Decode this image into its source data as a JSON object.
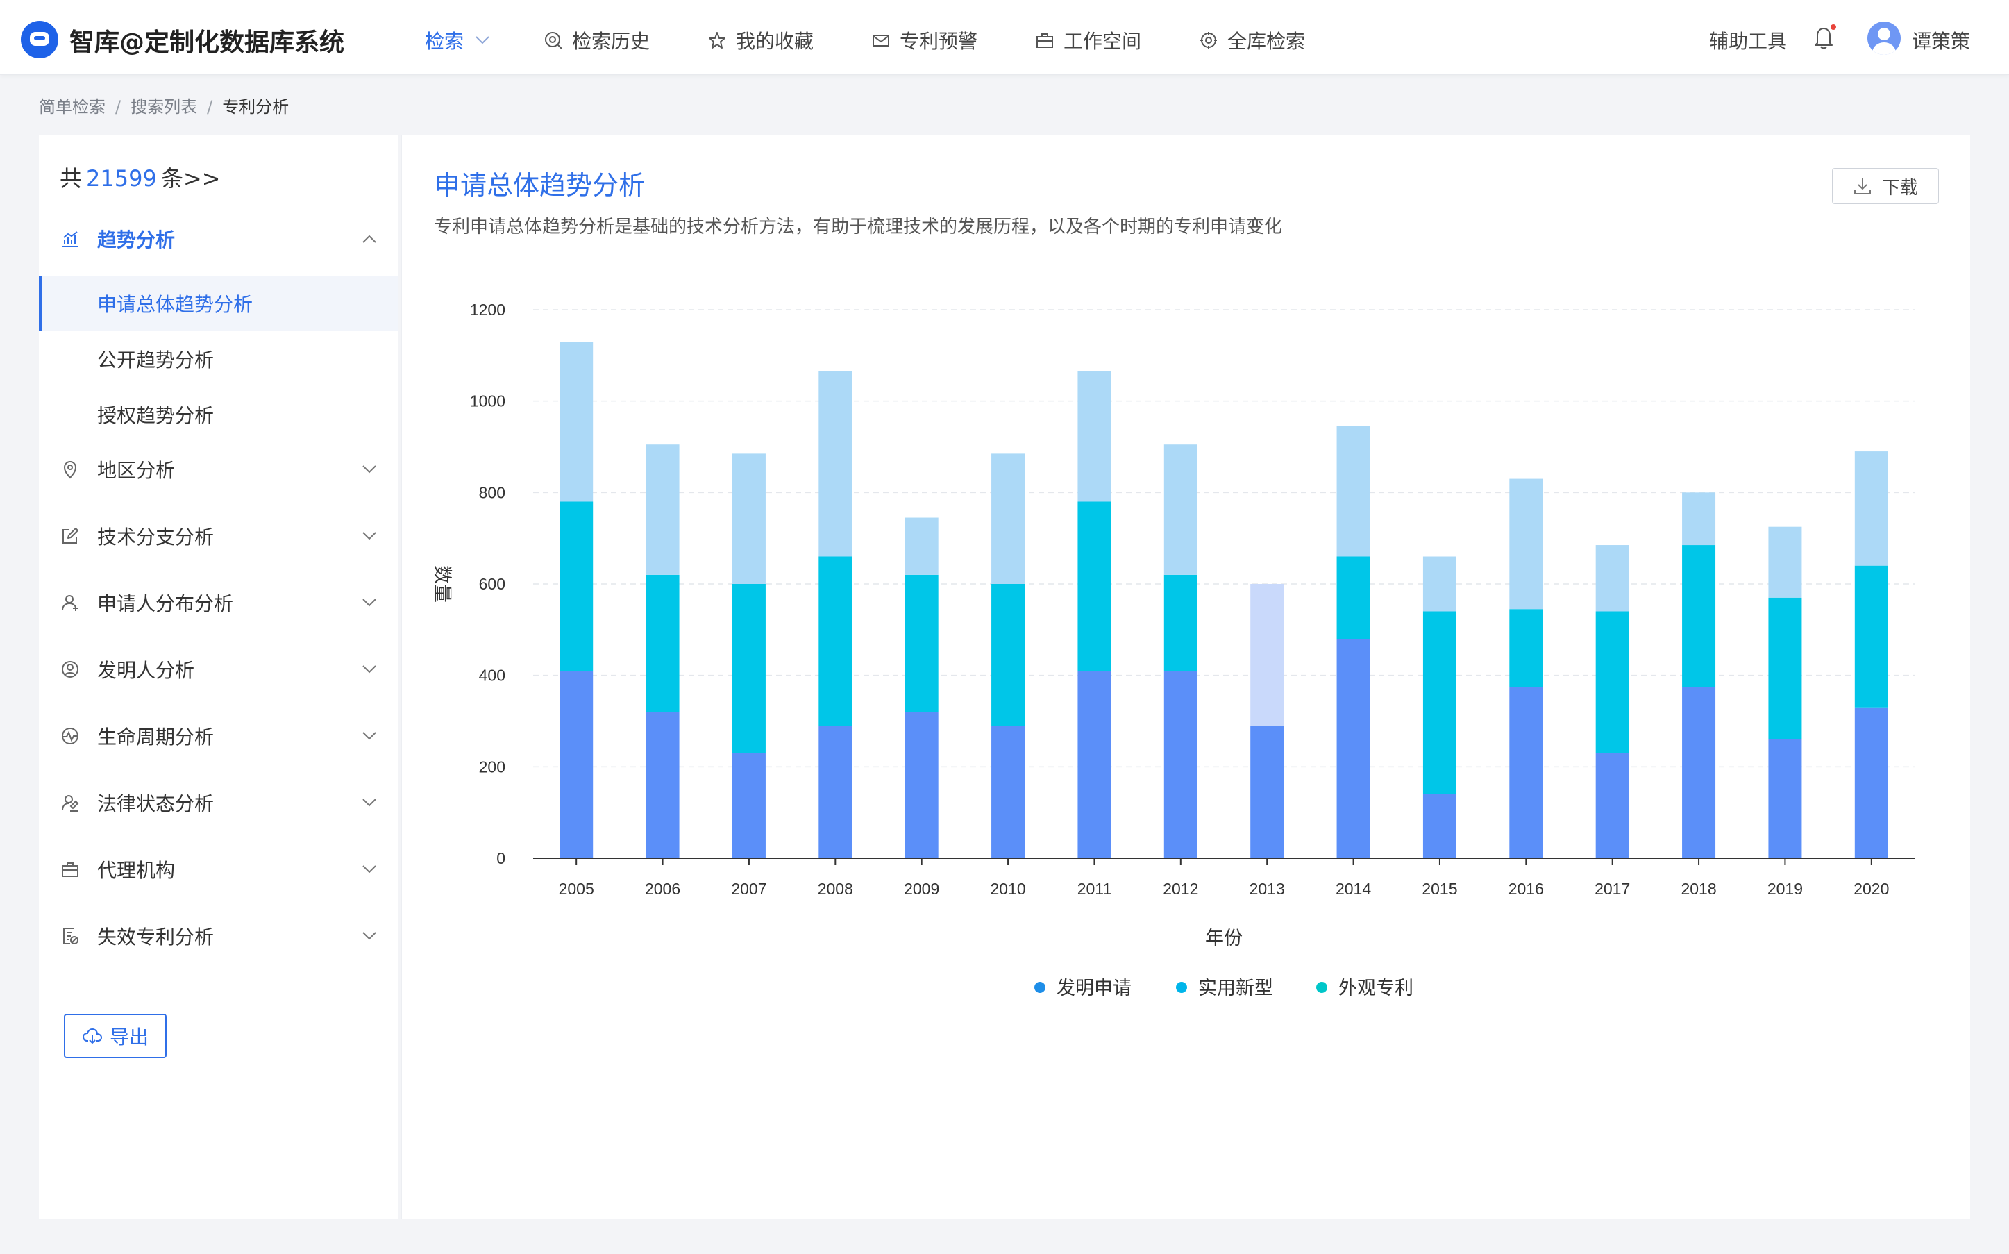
{
  "header": {
    "app_title": "智库@定制化数据库系统",
    "nav": [
      {
        "label": "检索",
        "active": true
      },
      {
        "label": "检索历史"
      },
      {
        "label": "我的收藏"
      },
      {
        "label": "专利预警"
      },
      {
        "label": "工作空间"
      },
      {
        "label": "全库检索"
      }
    ],
    "tools_label": "辅助工具",
    "username": "谭策策"
  },
  "breadcrumb": [
    "简单检索",
    "搜索列表",
    "专利分析"
  ],
  "sidebar": {
    "total_prefix": "共",
    "total_count": "21599",
    "total_suffix": "条>>",
    "menu": [
      {
        "label": "趋势分析",
        "icon": "trend-chart-icon",
        "expanded": true,
        "children": [
          {
            "label": "申请总体趋势分析",
            "active": true
          },
          {
            "label": "公开趋势分析"
          },
          {
            "label": "授权趋势分析"
          }
        ]
      },
      {
        "label": "地区分析",
        "icon": "location-pin-icon"
      },
      {
        "label": "技术分支分析",
        "icon": "edit-icon"
      },
      {
        "label": "申请人分布分析",
        "icon": "applicant-user-icon"
      },
      {
        "label": "发明人分析",
        "icon": "inventor-user-icon"
      },
      {
        "label": "生命周期分析",
        "icon": "lifecycle-icon"
      },
      {
        "label": "法律状态分析",
        "icon": "legal-status-icon"
      },
      {
        "label": "代理机构",
        "icon": "briefcase-icon"
      },
      {
        "label": "失效专利分析",
        "icon": "document-invalid-icon"
      }
    ],
    "export_label": "导出"
  },
  "main": {
    "title": "申请总体趋势分析",
    "description": "专利申请总体趋势分析是基础的技术分析方法，有助于梳理技术的发展历程，以及各个时期的专利申请变化",
    "download_label": "下载"
  },
  "chart_data": {
    "type": "bar",
    "stacked": true,
    "categories": [
      "2005",
      "2006",
      "2007",
      "2008",
      "2009",
      "2010",
      "2011",
      "2012",
      "2013",
      "2014",
      "2015",
      "2016",
      "2017",
      "2018",
      "2019",
      "2020"
    ],
    "series": [
      {
        "name": "发明申请",
        "color": "#5b8ff9",
        "values": [
          410,
          320,
          230,
          290,
          320,
          290,
          410,
          410,
          290,
          480,
          140,
          375,
          230,
          375,
          260,
          330
        ]
      },
      {
        "name": "实用新型",
        "color": "#00c6e8",
        "values": [
          370,
          300,
          370,
          370,
          300,
          310,
          370,
          210,
          310,
          180,
          400,
          170,
          310,
          310,
          310,
          310
        ]
      },
      {
        "name": "外观专利",
        "color": "#acd9f7",
        "values": [
          350,
          285,
          285,
          405,
          125,
          285,
          285,
          285,
          0,
          285,
          120,
          285,
          145,
          115,
          155,
          250
        ]
      }
    ],
    "highlight": {
      "category": "2013",
      "series": "实用新型",
      "color": "#c9d9fb"
    },
    "legend_marker_colors": [
      "#1e8ee8",
      "#00b5ea",
      "#00c6c9"
    ],
    "xlabel": "年份",
    "ylabel": "数量",
    "ylim": [
      0,
      1200
    ],
    "yticks": [
      0,
      200,
      400,
      600,
      800,
      1000,
      1200
    ],
    "grid": true,
    "legend_position": "bottom"
  }
}
